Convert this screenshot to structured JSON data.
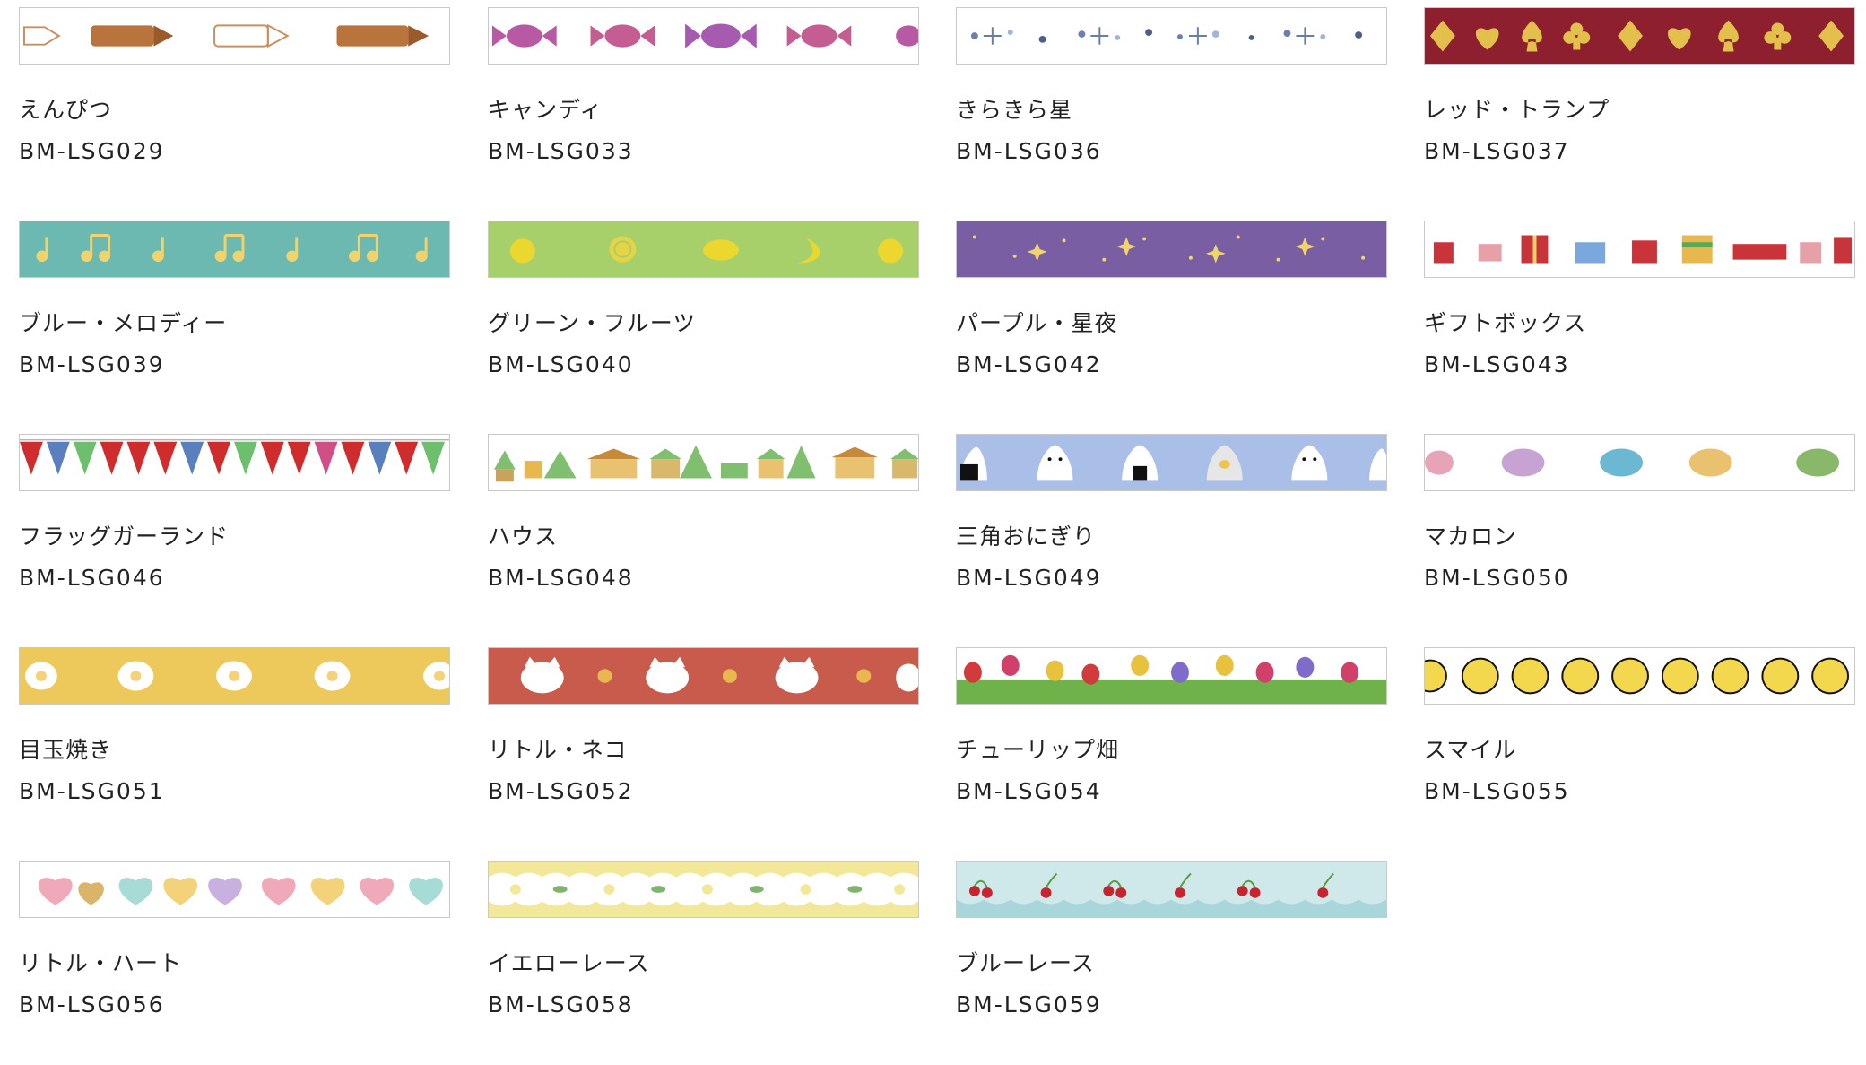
{
  "products": [
    {
      "name": "えんぴつ",
      "code": "BM-LSG029",
      "pattern": "pencil-pattern",
      "bg": "#ffffff"
    },
    {
      "name": "キャンディ",
      "code": "BM-LSG033",
      "pattern": "candy-pattern",
      "bg": "#ffffff"
    },
    {
      "name": "きらきら星",
      "code": "BM-LSG036",
      "pattern": "sparkle-star-pattern",
      "bg": "#ffffff"
    },
    {
      "name": "レッド・トランプ",
      "code": "BM-LSG037",
      "pattern": "card-suit-pattern",
      "bg": "#8e1f2e"
    },
    {
      "name": "ブルー・メロディー",
      "code": "BM-LSG039",
      "pattern": "music-note-pattern",
      "bg": "#6bb9b0"
    },
    {
      "name": "グリーン・フルーツ",
      "code": "BM-LSG040",
      "pattern": "fruit-pattern",
      "bg": "#a8d06a"
    },
    {
      "name": "パープル・星夜",
      "code": "BM-LSG042",
      "pattern": "night-star-pattern",
      "bg": "#7a5ea3"
    },
    {
      "name": "ギフトボックス",
      "code": "BM-LSG043",
      "pattern": "gift-box-pattern",
      "bg": "#ffffff"
    },
    {
      "name": "フラッグガーランド",
      "code": "BM-LSG046",
      "pattern": "flag-garland-pattern",
      "bg": "#ffffff"
    },
    {
      "name": "ハウス",
      "code": "BM-LSG048",
      "pattern": "house-pattern",
      "bg": "#ffffff"
    },
    {
      "name": "三角おにぎり",
      "code": "BM-LSG049",
      "pattern": "onigiri-pattern",
      "bg": "#a9bfe8"
    },
    {
      "name": "マカロン",
      "code": "BM-LSG050",
      "pattern": "macaron-pattern",
      "bg": "#ffffff"
    },
    {
      "name": "目玉焼き",
      "code": "BM-LSG051",
      "pattern": "fried-egg-pattern",
      "bg": "#ecc95a"
    },
    {
      "name": "リトル・ネコ",
      "code": "BM-LSG052",
      "pattern": "cat-pattern",
      "bg": "#c95b4c"
    },
    {
      "name": "チューリップ畑",
      "code": "BM-LSG054",
      "pattern": "tulip-pattern",
      "bg": "#ffffff"
    },
    {
      "name": "スマイル",
      "code": "BM-LSG055",
      "pattern": "smiley-pattern",
      "bg": "#ffffff"
    },
    {
      "name": "リトル・ハート",
      "code": "BM-LSG056",
      "pattern": "heart-pattern",
      "bg": "#ffffff"
    },
    {
      "name": "イエローレース",
      "code": "BM-LSG058",
      "pattern": "yellow-lace-pattern",
      "bg": "#f3e79a"
    },
    {
      "name": "ブルーレース",
      "code": "BM-LSG059",
      "pattern": "blue-lace-pattern",
      "bg": "#cfe8ea"
    }
  ]
}
